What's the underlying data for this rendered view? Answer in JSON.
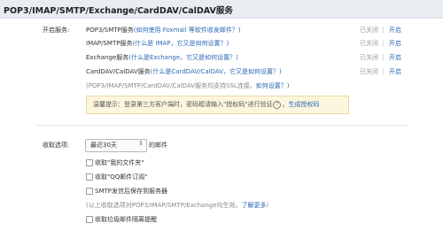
{
  "page": {
    "title": "POP3/IMAP/SMTP/Exchange/CardDAV/CalDAV服务"
  },
  "services": {
    "label": "开启服务:",
    "items": [
      {
        "name": "POP3/SMTP服务",
        "help": "(如何使用 Foxmail 等软件收发邮件？)",
        "status": "已关闭",
        "action": "开启"
      },
      {
        "name": "IMAP/SMTP服务",
        "help": "(什么是 IMAP，它又是如何设置？)",
        "status": "已关闭",
        "action": "开启"
      },
      {
        "name": "Exchange服务",
        "help": "(什么是Exchange，它又是如何设置？)",
        "status": "已关闭",
        "action": "开启"
      },
      {
        "name": "CardDAV/CalDAV服务",
        "help": "(什么是CardDAV/CalDAV，它又是如何设置？)",
        "status": "已关闭",
        "action": "开启"
      }
    ],
    "ssl_note": "(POP3/IMAP/SMTP/CardDAV/CalDAV服务均支持SSL连接。",
    "ssl_link": "如何设置？)",
    "separator": "|"
  },
  "notice": {
    "text": "温馨提示：登录第三方客户端时，密码框请输入\"授权码\"进行验证",
    "icon": "question-circle-icon",
    "icon_glyph": "?",
    "tail": "。",
    "link": "生成授权码"
  },
  "receive": {
    "label": "收取选项:",
    "select_value": "最近30天",
    "select_arrow": "⇕",
    "suffix": "的邮件",
    "options": [
      "收取\"我的文件夹\"",
      "收取\"QQ邮件订阅\"",
      "SMTP发信后保存到服务器"
    ],
    "note": "(以上收取选项对POP3/IMAP/SMTP/Exchange均生效。",
    "note_link": "了解更多",
    "note_tail": ")",
    "extra_option": "收取垃圾邮件隔离提醒"
  }
}
